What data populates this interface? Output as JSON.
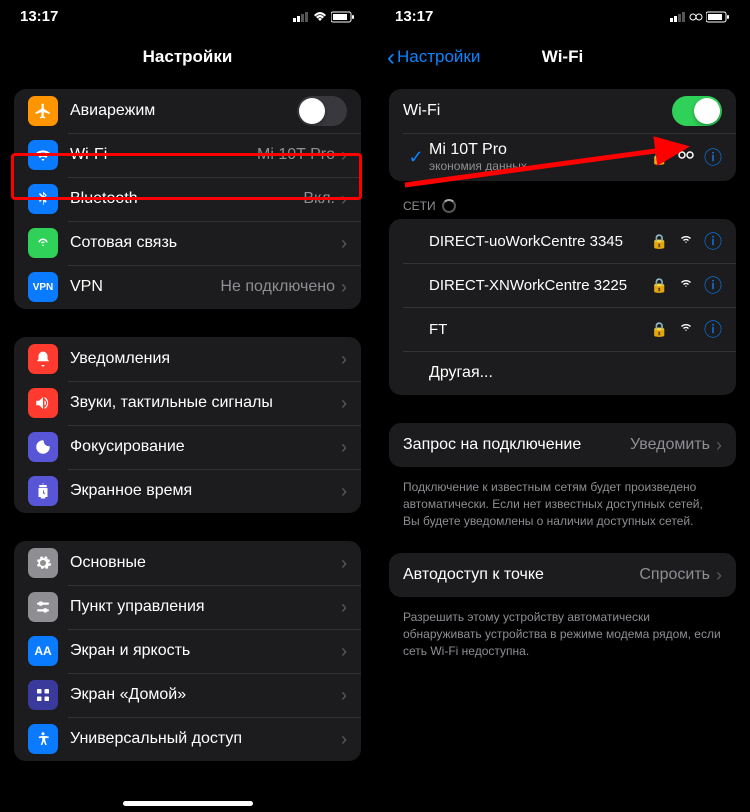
{
  "status": {
    "time": "13:17"
  },
  "left": {
    "title": "Настройки",
    "group1": [
      {
        "icon": "airplane",
        "bg": "#ff9500",
        "label": "Авиарежим",
        "toggle": "off"
      },
      {
        "icon": "wifi",
        "bg": "#0a7aff",
        "label": "Wi-Fi",
        "value": "Mi 10T Pro"
      },
      {
        "icon": "bluetooth",
        "bg": "#0a7aff",
        "label": "Bluetooth",
        "value": "Вкл."
      },
      {
        "icon": "cellular",
        "bg": "#30d158",
        "label": "Сотовая связь"
      },
      {
        "icon": "vpn",
        "bg": "#0a7aff",
        "label": "VPN",
        "value": "Не подключено"
      }
    ],
    "group2": [
      {
        "icon": "notifications",
        "bg": "#ff3b30",
        "label": "Уведомления"
      },
      {
        "icon": "sounds",
        "bg": "#ff3b30",
        "label": "Звуки, тактильные сигналы"
      },
      {
        "icon": "focus",
        "bg": "#5856d6",
        "label": "Фокусирование"
      },
      {
        "icon": "screentime",
        "bg": "#5856d6",
        "label": "Экранное время"
      }
    ],
    "group3": [
      {
        "icon": "general",
        "bg": "#8e8e93",
        "label": "Основные"
      },
      {
        "icon": "control",
        "bg": "#8e8e93",
        "label": "Пункт управления"
      },
      {
        "icon": "display",
        "bg": "#0a7aff",
        "label": "Экран и яркость"
      },
      {
        "icon": "home",
        "bg": "#3a3a9c",
        "label": "Экран «Домой»"
      },
      {
        "icon": "accessibility",
        "bg": "#0a7aff",
        "label": "Универсальный доступ"
      }
    ]
  },
  "right": {
    "back": "Настройки",
    "title": "Wi-Fi",
    "wifi_label": "Wi-Fi",
    "connected": {
      "name": "Mi 10T Pro",
      "sub": "экономия данных"
    },
    "networks_label": "СЕТИ",
    "networks": [
      {
        "name": "DIRECT-uoWorkCentre 3345",
        "lock": true
      },
      {
        "name": "DIRECT-XNWorkCentre 3225",
        "lock": true
      },
      {
        "name": "FT",
        "lock": true
      }
    ],
    "other": "Другая...",
    "ask": {
      "label": "Запрос на подключение",
      "value": "Уведомить"
    },
    "ask_footer": "Подключение к известным сетям будет произведено автоматически. Если нет известных доступных сетей, Вы будете уведомлены о наличии доступных сетей.",
    "hotspot": {
      "label": "Автодоступ к точке",
      "value": "Спросить"
    },
    "hotspot_footer": "Разрешить этому устройству автоматически обнаруживать устройства в режиме модема рядом, если сеть Wi-Fi недоступна."
  }
}
